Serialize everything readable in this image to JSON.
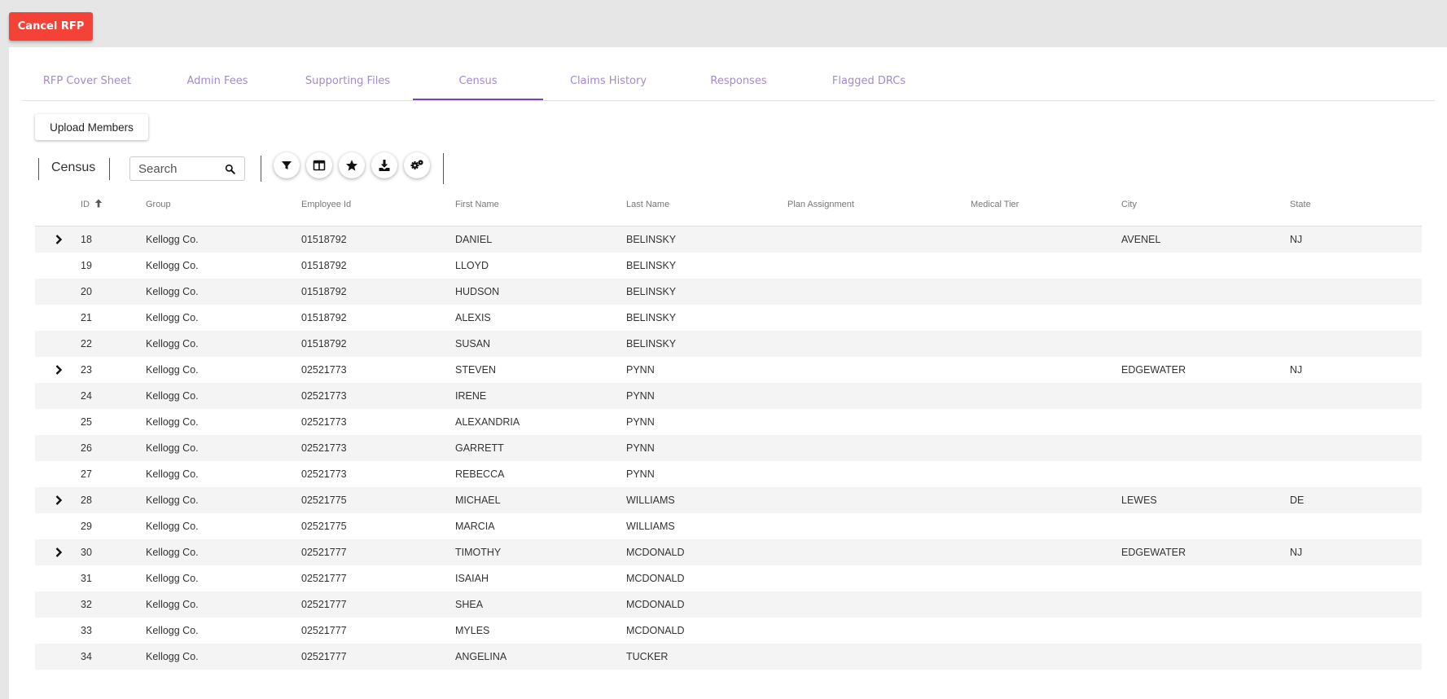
{
  "header": {
    "cancel_label": "Cancel RFP"
  },
  "tabs": [
    {
      "label": "RFP Cover Sheet",
      "active": false
    },
    {
      "label": "Admin Fees",
      "active": false
    },
    {
      "label": "Supporting Files",
      "active": false
    },
    {
      "label": "Census",
      "active": true
    },
    {
      "label": "Claims History",
      "active": false
    },
    {
      "label": "Responses",
      "active": false
    },
    {
      "label": "Flagged DRCs",
      "active": false
    }
  ],
  "toolbar": {
    "upload_label": "Upload Members",
    "census_label": "Census",
    "search_placeholder": "Search",
    "search_value": "",
    "icons": [
      "filter-icon",
      "columns-icon",
      "star-icon",
      "download-icon",
      "settings-icon"
    ]
  },
  "colors": {
    "accent": "#7b3fbe",
    "tab_text": "#a48ac8",
    "cancel": "#f44336"
  },
  "table": {
    "columns": [
      "ID",
      "Group",
      "Employee Id",
      "First Name",
      "Last Name",
      "Plan Assignment",
      "Medical Tier",
      "City",
      "State"
    ],
    "sort_column": "ID",
    "sort_direction": "ascending",
    "rows": [
      {
        "expandable": true,
        "cells": [
          "18",
          "Kellogg Co.",
          "01518792",
          "DANIEL",
          "BELINSKY",
          "",
          "",
          "AVENEL",
          "NJ"
        ]
      },
      {
        "expandable": false,
        "cells": [
          "19",
          "Kellogg Co.",
          "01518792",
          "LLOYD",
          "BELINSKY",
          "",
          "",
          "",
          ""
        ]
      },
      {
        "expandable": false,
        "cells": [
          "20",
          "Kellogg Co.",
          "01518792",
          "HUDSON",
          "BELINSKY",
          "",
          "",
          "",
          ""
        ]
      },
      {
        "expandable": false,
        "cells": [
          "21",
          "Kellogg Co.",
          "01518792",
          "ALEXIS",
          "BELINSKY",
          "",
          "",
          "",
          ""
        ]
      },
      {
        "expandable": false,
        "cells": [
          "22",
          "Kellogg Co.",
          "01518792",
          "SUSAN",
          "BELINSKY",
          "",
          "",
          "",
          ""
        ]
      },
      {
        "expandable": true,
        "cells": [
          "23",
          "Kellogg Co.",
          "02521773",
          "STEVEN",
          "PYNN",
          "",
          "",
          "EDGEWATER",
          "NJ"
        ]
      },
      {
        "expandable": false,
        "cells": [
          "24",
          "Kellogg Co.",
          "02521773",
          "IRENE",
          "PYNN",
          "",
          "",
          "",
          ""
        ]
      },
      {
        "expandable": false,
        "cells": [
          "25",
          "Kellogg Co.",
          "02521773",
          "ALEXANDRIA",
          "PYNN",
          "",
          "",
          "",
          ""
        ]
      },
      {
        "expandable": false,
        "cells": [
          "26",
          "Kellogg Co.",
          "02521773",
          "GARRETT",
          "PYNN",
          "",
          "",
          "",
          ""
        ]
      },
      {
        "expandable": false,
        "cells": [
          "27",
          "Kellogg Co.",
          "02521773",
          "REBECCA",
          "PYNN",
          "",
          "",
          "",
          ""
        ]
      },
      {
        "expandable": true,
        "cells": [
          "28",
          "Kellogg Co.",
          "02521775",
          "MICHAEL",
          "WILLIAMS",
          "",
          "",
          "LEWES",
          "DE"
        ]
      },
      {
        "expandable": false,
        "cells": [
          "29",
          "Kellogg Co.",
          "02521775",
          "MARCIA",
          "WILLIAMS",
          "",
          "",
          "",
          ""
        ]
      },
      {
        "expandable": true,
        "cells": [
          "30",
          "Kellogg Co.",
          "02521777",
          "TIMOTHY",
          "MCDONALD",
          "",
          "",
          "EDGEWATER",
          "NJ"
        ]
      },
      {
        "expandable": false,
        "cells": [
          "31",
          "Kellogg Co.",
          "02521777",
          "ISAIAH",
          "MCDONALD",
          "",
          "",
          "",
          ""
        ]
      },
      {
        "expandable": false,
        "cells": [
          "32",
          "Kellogg Co.",
          "02521777",
          "SHEA",
          "MCDONALD",
          "",
          "",
          "",
          ""
        ]
      },
      {
        "expandable": false,
        "cells": [
          "33",
          "Kellogg Co.",
          "02521777",
          "MYLES",
          "MCDONALD",
          "",
          "",
          "",
          ""
        ]
      },
      {
        "expandable": false,
        "cells": [
          "34",
          "Kellogg Co.",
          "02521777",
          "ANGELINA",
          "TUCKER",
          "",
          "",
          "",
          ""
        ]
      }
    ]
  }
}
